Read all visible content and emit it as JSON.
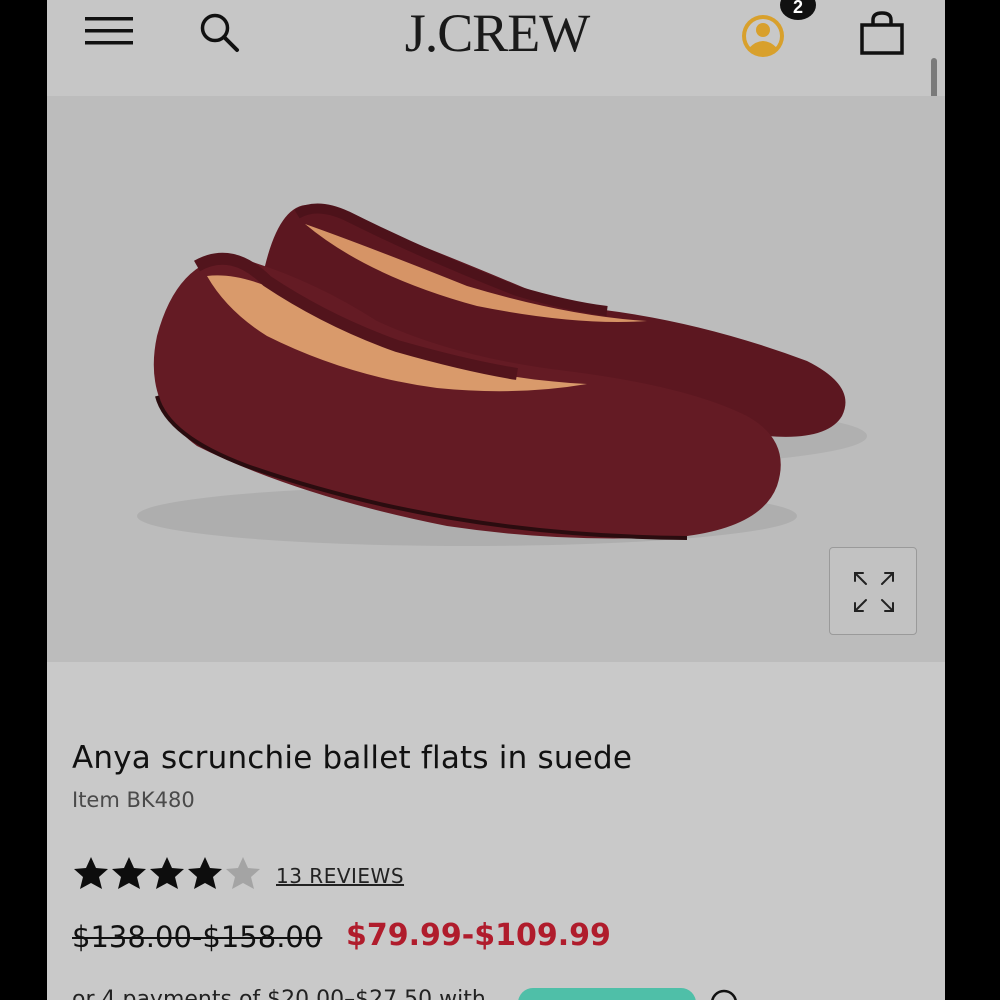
{
  "header": {
    "brand": "J.CREW",
    "cart_badge": "2",
    "icons": [
      "menu-icon",
      "search-icon",
      "account-icon",
      "shopping-bag-icon"
    ],
    "account_color": "#d8a02c"
  },
  "product": {
    "title": "Anya scrunchie ballet flats in suede",
    "item": "Item BK480",
    "rating": {
      "value": 4,
      "max": 5
    },
    "reviews_label": "13 REVIEWS",
    "original_price": "$138.00-$158.00",
    "sale_price": "$79.99-$109.99",
    "sale_color": "#b01c2c",
    "installment_text": "or 4 payments of $20.00–$27.50 with"
  },
  "image": {
    "alt_icon": "expand-icon",
    "shoe_color": "#5e1820"
  }
}
